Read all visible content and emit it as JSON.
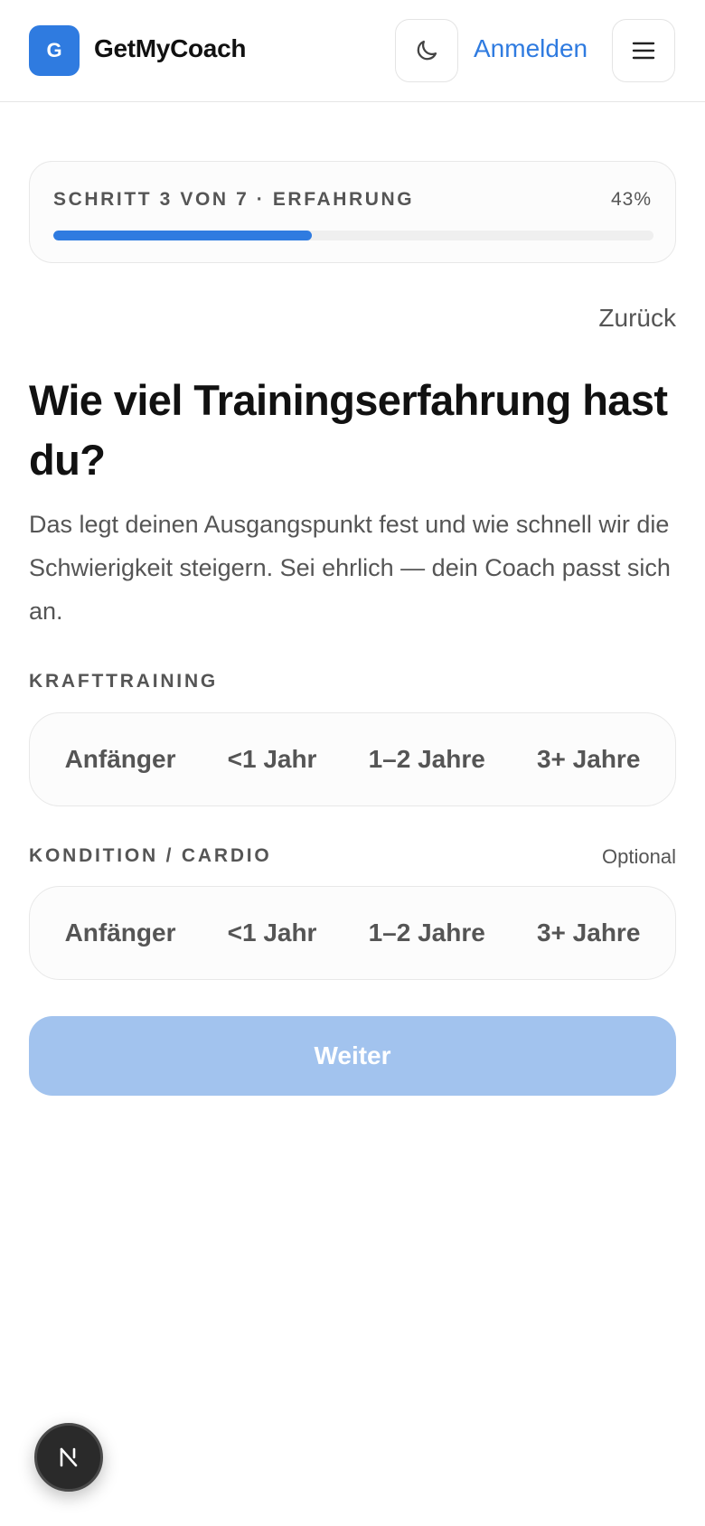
{
  "header": {
    "logo_letter": "G",
    "app_name": "GetMyCoach",
    "login_label": "Anmelden",
    "theme_icon": "moon-icon",
    "menu_icon": "hamburger-icon"
  },
  "progress": {
    "label": "SCHRITT 3 VON 7 · ERFAHRUNG",
    "percent_text": "43%",
    "value": 0.43
  },
  "back_label": "Zurück",
  "question": {
    "title": "Wie viel Trainingserfahrung hast du?",
    "subtitle": "Das legt deinen Ausgangspunkt fest und wie schnell wir die Schwierigkeit steigern. Sei ehrlich — dein Coach passt sich an."
  },
  "strength": {
    "label": "KRAFTTRAINING",
    "options": [
      "Anfänger",
      "<1 Jahr",
      "1–2 Jahre",
      "3+ Jahre"
    ]
  },
  "cardio": {
    "label": "KONDITION / CARDIO",
    "optional_label": "Optional",
    "options": [
      "Anfänger",
      "<1 Jahr",
      "1–2 Jahre",
      "3+ Jahre"
    ]
  },
  "next_label": "Weiter",
  "dev_badge_icon": "nextjs-icon",
  "colors": {
    "accent": "#2f7be0",
    "button_disabled": "#a2c3ee"
  }
}
